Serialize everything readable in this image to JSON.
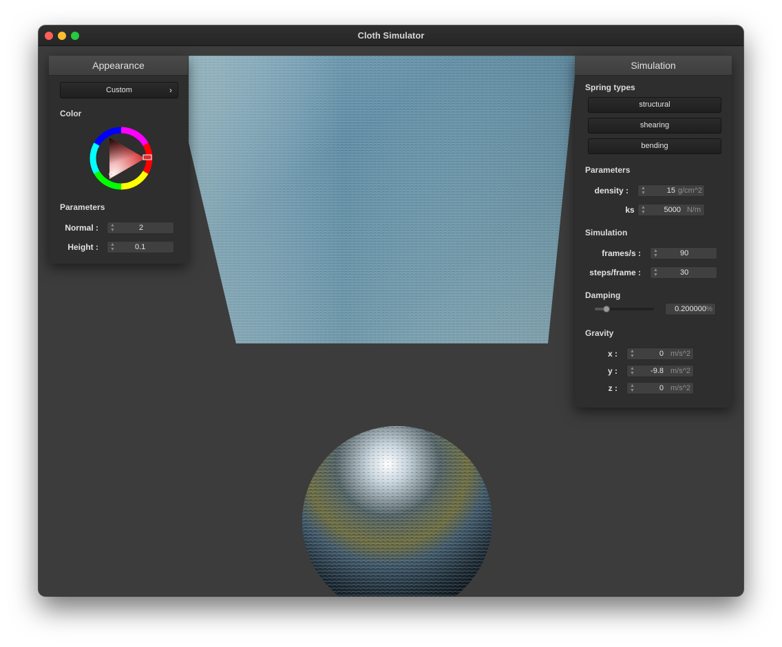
{
  "window": {
    "title": "Cloth Simulator"
  },
  "appearance": {
    "header": "Appearance",
    "shader": {
      "selected": "Custom",
      "arrow": "›"
    },
    "color_label": "Color",
    "color_wheel": {
      "selected_color": "#d83030"
    },
    "parameters_label": "Parameters",
    "normal": {
      "label": "Normal :",
      "value": "2"
    },
    "height": {
      "label": "Height :",
      "value": "0.1"
    }
  },
  "simulation": {
    "header": "Simulation",
    "spring_types_label": "Spring types",
    "spring_buttons": [
      "structural",
      "shearing",
      "bending"
    ],
    "parameters_label": "Parameters",
    "density": {
      "label": "density :",
      "value": "15",
      "unit": "g/cm^2"
    },
    "ks": {
      "label": "ks :",
      "value": "5000",
      "unit": "N/m"
    },
    "simulation_label": "Simulation",
    "frames": {
      "label": "frames/s :",
      "value": "90"
    },
    "steps": {
      "label": "steps/frame :",
      "value": "30"
    },
    "damping_label": "Damping",
    "damping": {
      "value": "0.200000",
      "unit": "%",
      "slider_fraction": 0.2
    },
    "gravity_label": "Gravity",
    "gravity": [
      {
        "label": "x :",
        "value": "0",
        "unit": "m/s^2"
      },
      {
        "label": "y :",
        "value": "-9.8",
        "unit": "m/s^2"
      },
      {
        "label": "z :",
        "value": "0",
        "unit": "m/s^2"
      }
    ]
  },
  "icons": {
    "spinner": "up-down-spinner-icon",
    "submenu": "chevron-right-icon"
  }
}
